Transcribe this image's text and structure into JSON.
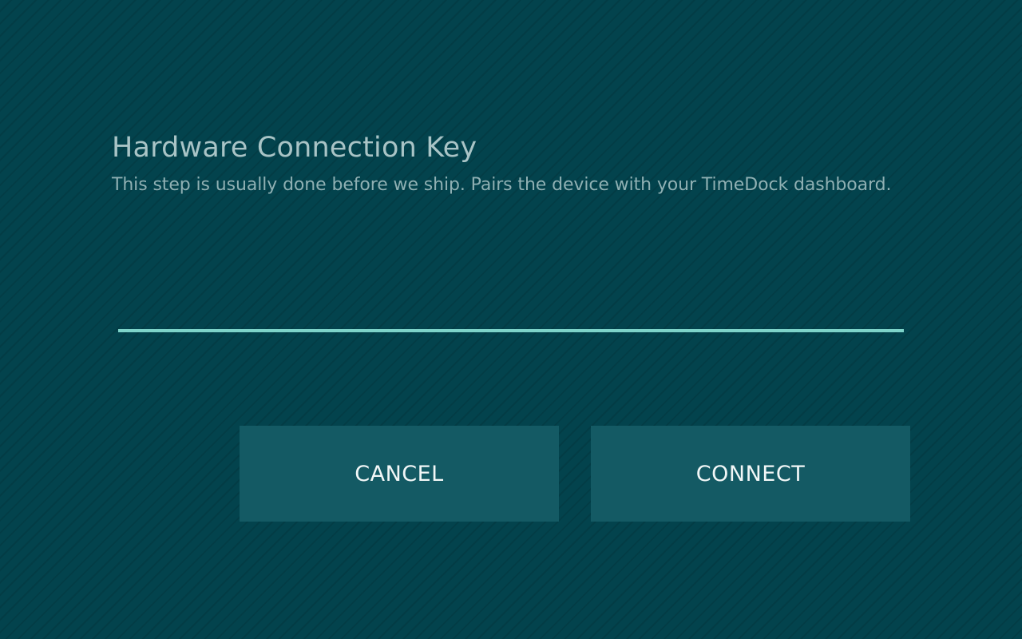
{
  "dialog": {
    "title": "Hardware Connection Key",
    "subtitle": "This step is usually done before we ship. Pairs the device with your TimeDock dashboard.",
    "key_input": {
      "value": "",
      "placeholder": ""
    },
    "cancel_label": "CANCEL",
    "connect_label": "CONNECT"
  },
  "colors": {
    "background": "#03434d",
    "title_text": "#a9c4c6",
    "input_underline": "#7dd3c9",
    "button_bg": "#145a64",
    "button_text": "#f2f7f7"
  }
}
